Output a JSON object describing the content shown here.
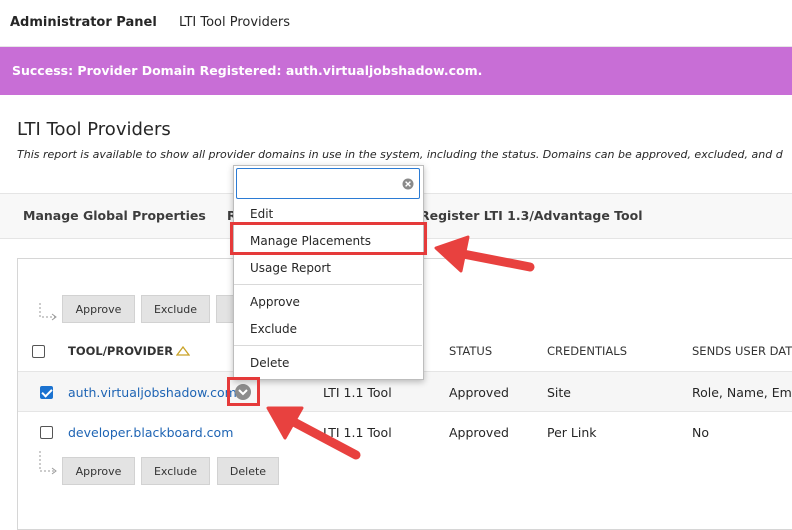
{
  "breadcrumb": {
    "root": "Administrator Panel",
    "current": "LTI Tool Providers"
  },
  "banner": {
    "message": "Success: Provider Domain Registered: auth.virtualjobshadow.com."
  },
  "page": {
    "title": "LTI Tool Providers",
    "description": "This report is available to show all provider domains in use in the system, including the status. Domains can be approved, excluded, and d"
  },
  "actions": {
    "manage_global": "Manage Global Properties",
    "partial": "R",
    "register": "Register LTI 1.3/Advantage Tool"
  },
  "buttons": {
    "approve": "Approve",
    "exclude": "Exclude",
    "delete": "Delete"
  },
  "table": {
    "headers": {
      "tool": "TOOL/PROVIDER",
      "status": "STATUS",
      "credentials": "CREDENTIALS",
      "sends": "SENDS USER DAT"
    },
    "rows": [
      {
        "provider": "auth.virtualjobshadow.com",
        "type": "LTI 1.1 Tool",
        "status": "Approved",
        "credentials": "Site",
        "sends": "Role, Name, Ema",
        "checked": true
      },
      {
        "provider": "developer.blackboard.com",
        "type": "LTI 1.1 Tool",
        "status": "Approved",
        "credentials": "Per Link",
        "sends": "No",
        "checked": false
      }
    ]
  },
  "menu": {
    "search_value": "",
    "items": [
      "Edit",
      "Manage Placements",
      "Usage Report",
      "Approve",
      "Exclude",
      "Delete"
    ]
  },
  "colors": {
    "banner": "#c86ed6",
    "link": "#1e64b4",
    "highlight": "#e53a3a",
    "focus": "#2b7bd4"
  },
  "icons": {
    "sort": "sort-ascending-icon",
    "row_menu": "chevron-down-circle-icon",
    "clear": "clear-circle-icon",
    "arrow": "annotation-arrow-icon"
  }
}
